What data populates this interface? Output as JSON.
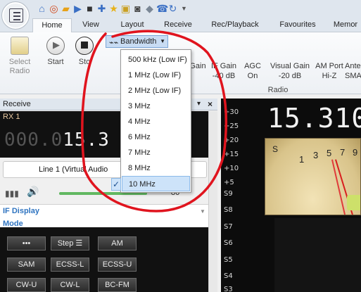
{
  "tabs": [
    {
      "label": "Home",
      "active": true
    },
    {
      "label": "View",
      "active": false
    },
    {
      "label": "Layout",
      "active": false
    },
    {
      "label": "Receive",
      "active": false
    },
    {
      "label": "Rec/Playback",
      "active": false
    },
    {
      "label": "Favourites",
      "active": false
    },
    {
      "label": "Memor",
      "active": false
    }
  ],
  "ribbon": {
    "select_radio": "Select\nRadio",
    "start": "Start",
    "stop": "Sto",
    "bandwidth": "Bandwidth",
    "gain": "Gain",
    "if_gain": "IF Gain",
    "if_gain_val": "-40 dB",
    "agc": "AGC",
    "agc_val": "On",
    "visual_gain": "Visual Gain",
    "visual_gain_val": "-20 dB",
    "am_port": "AM Port",
    "am_port_val": "Hi-Z",
    "ante": "Ante",
    "ante_val": "SMA",
    "group_radio": "Radio"
  },
  "bandwidth_menu": [
    {
      "label": "500 kHz (Low IF)",
      "selected": false
    },
    {
      "label": "1 MHz (Low IF)",
      "selected": false
    },
    {
      "label": "2 MHz (Low IF)",
      "selected": false
    },
    {
      "label": "3 MHz",
      "selected": false
    },
    {
      "label": "4 MHz",
      "selected": false
    },
    {
      "label": "6 MHz",
      "selected": false
    },
    {
      "label": "7 MHz",
      "selected": false
    },
    {
      "label": "8 MHz",
      "selected": false
    },
    {
      "label": "10 MHz",
      "selected": true
    }
  ],
  "receive_panel": {
    "title": "Receive",
    "rx_label": "RX 1",
    "freq_dim": "000.0",
    "freq_lit": "15.3",
    "line_select": "Line 1 (Virtual Audio",
    "volume_value": "80",
    "volume_fraction": 0.78,
    "if_display": "IF Display",
    "mode": "Mode"
  },
  "mode_buttons": [
    [
      "•••",
      "Step ☰",
      "AM"
    ],
    [
      "SAM",
      "ECSS-L",
      "ECSS-U"
    ],
    [
      "CW-U",
      "CW-L",
      "BC-FM"
    ]
  ],
  "s_meter": {
    "scale": [
      "+30",
      "+25",
      "+20",
      "+15",
      "+10",
      "+5",
      "S9",
      "S8",
      "S7",
      "S6",
      "S5",
      "S4",
      "S3"
    ],
    "big_freq": "15.310",
    "meter_label": "S",
    "meter_ticks": [
      "1",
      "3",
      "5",
      "7",
      "9"
    ]
  },
  "colors": {
    "accent": "#2f74c0",
    "annotation": "#e0141e",
    "selection": "#cde3f9"
  }
}
